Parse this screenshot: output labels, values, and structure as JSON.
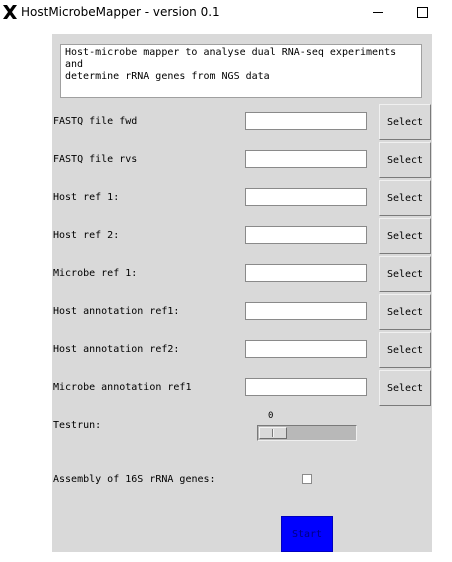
{
  "window": {
    "title": "HostMicrobeMapper - version 0.1",
    "icon": "x-app-icon",
    "controls": [
      "minimize-icon",
      "maximize-icon"
    ]
  },
  "description": "Host-microbe mapper to analyse dual RNA-seq experiments and\ndetermine rRNA genes from NGS data",
  "rows": [
    {
      "label": "FASTQ file fwd",
      "value": "",
      "button": "Select"
    },
    {
      "label": "FASTQ file rvs",
      "value": "",
      "button": "Select"
    },
    {
      "label": "Host ref 1:",
      "value": "",
      "button": "Select"
    },
    {
      "label": "Host ref 2:",
      "value": "",
      "button": "Select"
    },
    {
      "label": "Microbe ref 1:",
      "value": "",
      "button": "Select"
    },
    {
      "label": "Host annotation ref1:",
      "value": "",
      "button": "Select"
    },
    {
      "label": "Host annotation ref2:",
      "value": "",
      "button": "Select"
    },
    {
      "label": "Microbe annotation ref1",
      "value": "",
      "button": "Select"
    }
  ],
  "testrun": {
    "label": "Testrun:",
    "value": "0"
  },
  "assembly": {
    "label": "Assembly of 16S rRNA genes:",
    "checked": false
  },
  "start": {
    "label": "Start",
    "color": "#0000ff"
  }
}
